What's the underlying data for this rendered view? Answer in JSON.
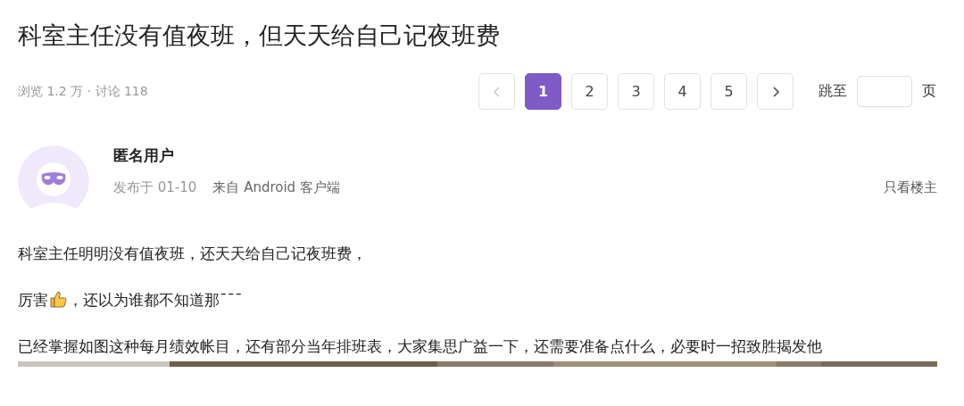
{
  "title": "科室主任没有值夜班，但天天给自己记夜班费",
  "stats": "浏览 1.2 万 · 讨论 118",
  "pagination": {
    "prev": {
      "disabled": true
    },
    "pages": [
      {
        "label": "1",
        "selected": true
      },
      {
        "label": "2",
        "selected": false
      },
      {
        "label": "3",
        "selected": false
      },
      {
        "label": "4",
        "selected": false
      },
      {
        "label": "5",
        "selected": false
      }
    ],
    "next": {
      "disabled": false
    },
    "jump_label": "跳至",
    "page_unit": "页"
  },
  "post": {
    "author": "匿名用户",
    "posted": "发布于 01-10",
    "source": "来自 Android 客户端",
    "only_op": "只看楼主",
    "paragraphs": [
      {
        "kind": "text",
        "text": "科室主任明明没有值夜班，还天天给自己记夜班费，"
      },
      {
        "kind": "emoji",
        "before": "厉害",
        "after": "，还以为谁都不知道那¯¯¯"
      },
      {
        "kind": "text",
        "text": "已经掌握如图这种每月绩效帐目，还有部分当年排班表，大家集思广益一下，还需要准备点什么，必要时一招致胜揭发他"
      }
    ]
  }
}
